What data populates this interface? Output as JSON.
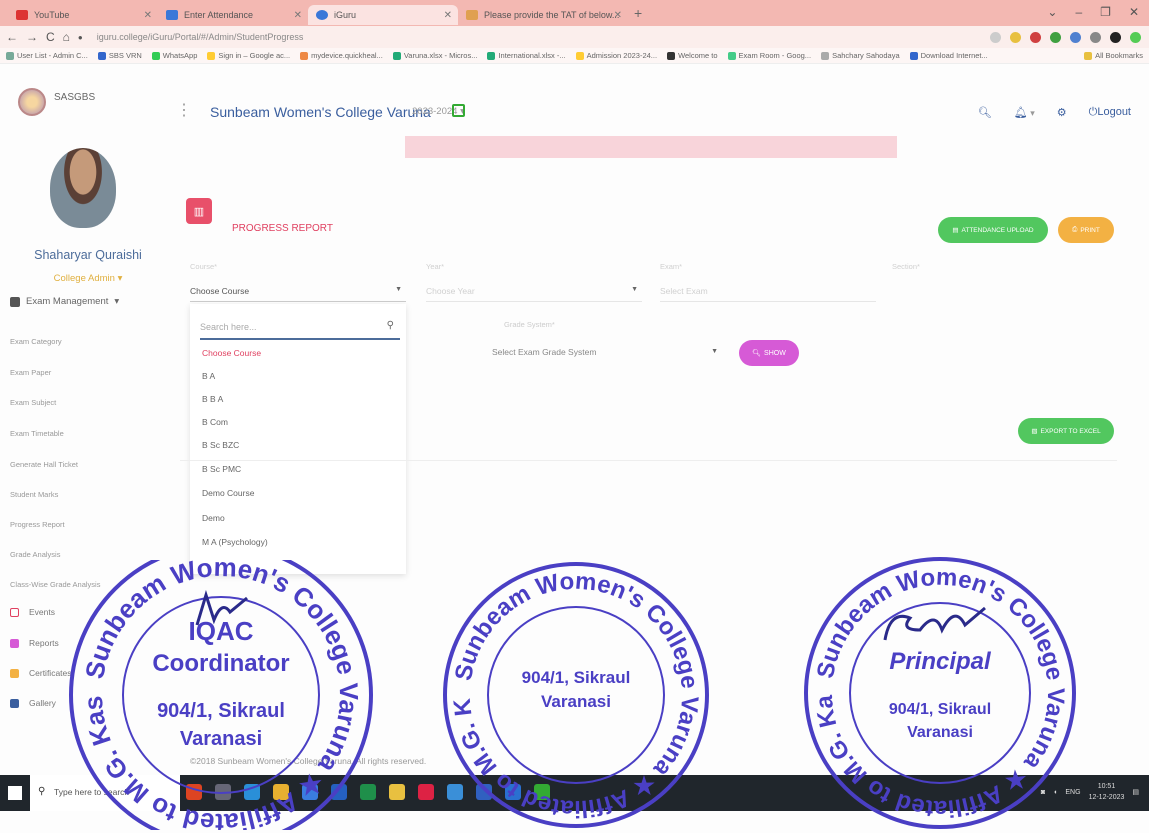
{
  "browser": {
    "tabs": [
      {
        "label": "YouTube"
      },
      {
        "label": "Enter Attendance"
      },
      {
        "label": "iGuru"
      },
      {
        "label": "Please provide the TAT of below..."
      }
    ],
    "url": "iguru.college/iGuru/Portal/#/Admin/StudentProgress",
    "bookmarks": [
      "User List - Admin C...",
      "SBS VRN",
      "WhatsApp",
      "Sign in – Google ac...",
      "mydevice.quickheal...",
      "Varuna.xlsx - Micros...",
      "International.xlsx -...",
      "Admission 2023-24...",
      "Welcome to",
      "Exam Room - Goog...",
      "Sahchary Sahodaya",
      "Download Internet..."
    ],
    "all_bookmarks": "All Bookmarks"
  },
  "sidebar": {
    "brand": "SASGBS",
    "user_name": "Shaharyar Quraishi",
    "user_role": "College Admin",
    "menu_head": "Exam Management",
    "items": [
      "Exam Category",
      "Exam Paper",
      "Exam Subject",
      "Exam Timetable",
      "Generate Hall Ticket",
      "Student Marks",
      "Progress Report",
      "Grade Analysis",
      "Class-Wise Grade Analysis"
    ],
    "icon_items": [
      "Events",
      "Reports",
      "Certificates",
      "Gallery"
    ]
  },
  "header": {
    "college": "Sunbeam Women's College Varuna",
    "year": "2023-2024",
    "logout": "Logout"
  },
  "page": {
    "title": "PROGRESS REPORT",
    "attendance_upload": "ATTENDANCE UPLOAD",
    "print": "PRINT",
    "export_excel": "EXPORT TO EXCEL",
    "show": "SHOW",
    "labels": {
      "course": "Course*",
      "year": "Year*",
      "exam": "Exam*",
      "section": "Section*",
      "grade": "Grade System*"
    },
    "course_value": "Choose Course",
    "year_placeholder": "Choose Year",
    "exam_placeholder": "Select Exam",
    "grade_placeholder": "Select Exam Grade System",
    "search_placeholder": "Search here...",
    "courses": [
      "Choose Course",
      "B A",
      "B B A",
      "B Com",
      "B Sc BZC",
      "B Sc PMC",
      "Demo Course",
      "Demo",
      "M A (Psychology)"
    ]
  },
  "footer": {
    "copyright": "©2018 Sunbeam Women's College Varuna. All rights reserved."
  },
  "taskbar": {
    "search": "Type here to search",
    "lang": "ENG",
    "time": "10:51",
    "date": "12-12-2023"
  },
  "stamps": [
    {
      "ring": "Sunbeam Women's College Varuna ★ Affiliated to M.G. Kashi Vidyapith ★",
      "line1": "IQAC",
      "line2": "Coordinator",
      "line3": "904/1, Sikraul",
      "line4": "Varanasi"
    },
    {
      "ring": "Sunbeam Women's College Varuna ★ Affiliated to M.G. Kashi Vidyapith ★",
      "line1": "904/1, Sikraul",
      "line2": "Varanasi"
    },
    {
      "ring": "Sunbeam Women's College Varuna ★ Affiliated to M.G. Kashi Vidyapith ★",
      "line1": "Principal",
      "line2": "904/1, Sikraul",
      "line3": "Varanasi"
    }
  ],
  "colors": {
    "accent": "#e04060",
    "brand_blue": "#3a5e9e",
    "green": "#52c75f",
    "orange": "#f3b143",
    "stamp": "#4a3fc4"
  }
}
